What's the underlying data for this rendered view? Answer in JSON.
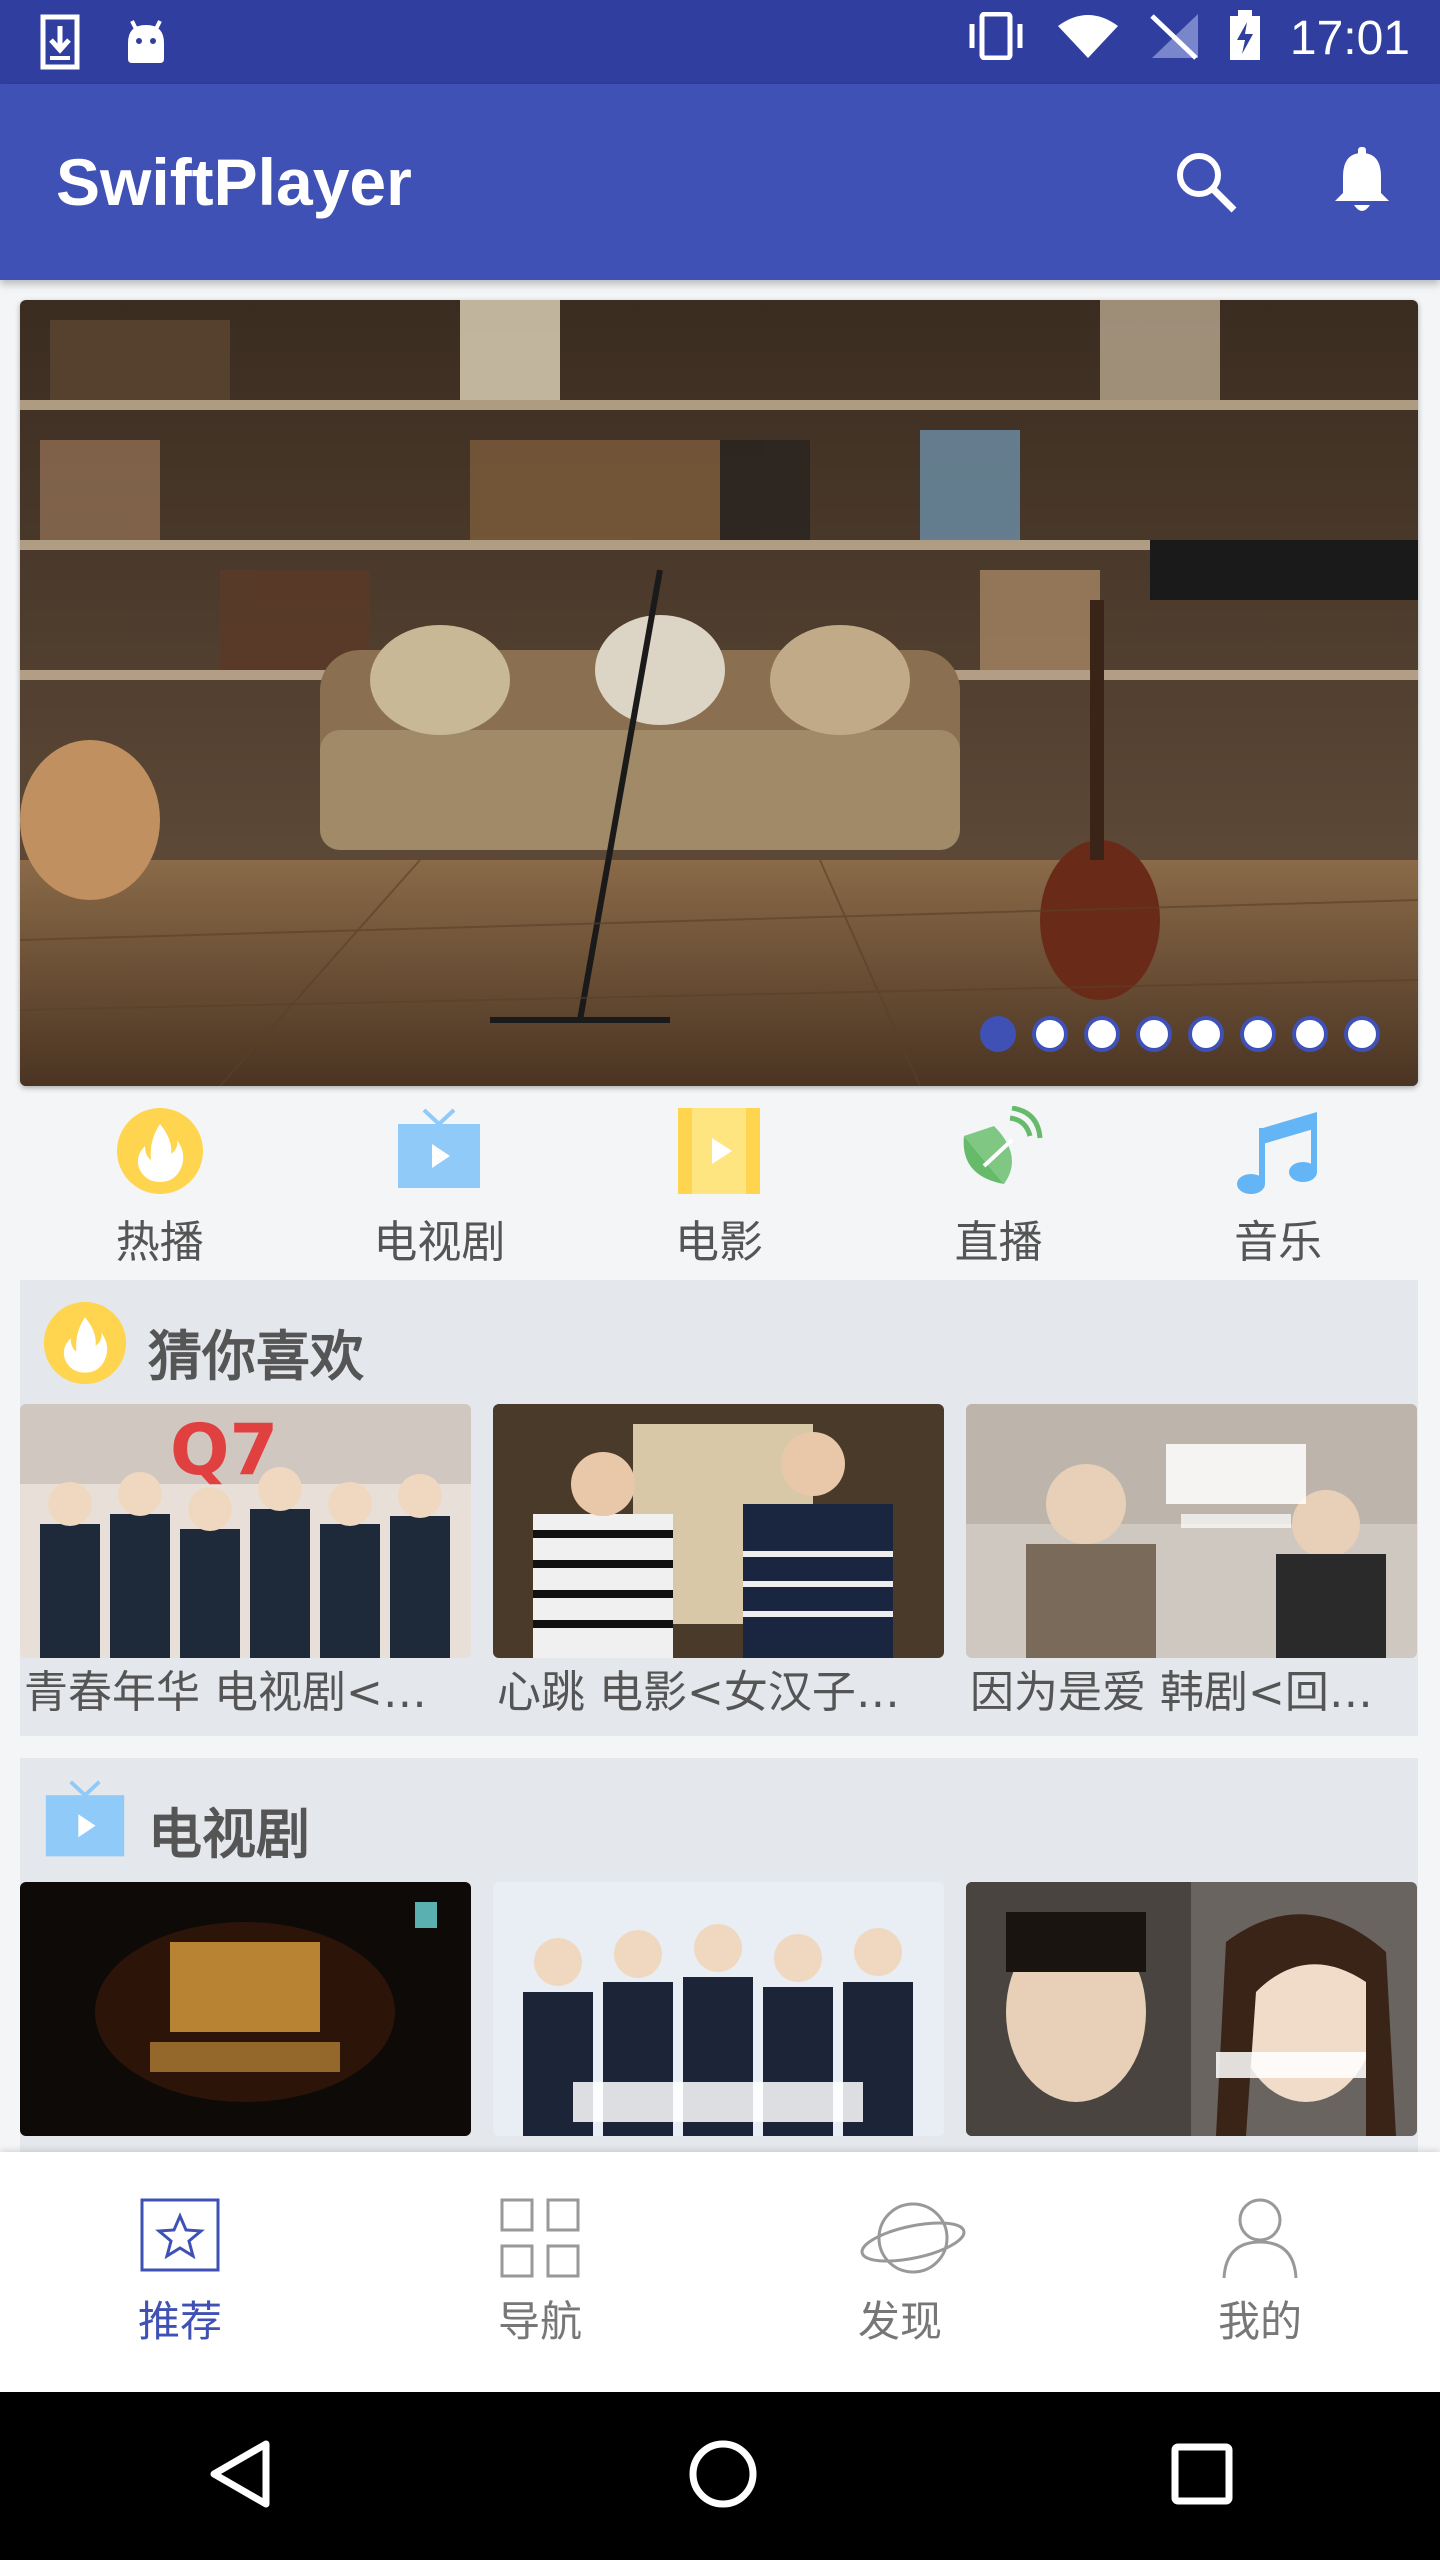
{
  "status_bar": {
    "time": "17:01"
  },
  "app_bar": {
    "title": "SwiftPlayer"
  },
  "banner": {
    "page_count": 8,
    "active_index": 0
  },
  "categories": [
    {
      "label": "热播",
      "icon": "fire-icon"
    },
    {
      "label": "电视剧",
      "icon": "tv-icon"
    },
    {
      "label": "电影",
      "icon": "film-icon"
    },
    {
      "label": "直播",
      "icon": "satellite-dish-icon"
    },
    {
      "label": "音乐",
      "icon": "music-note-icon"
    }
  ],
  "sections": [
    {
      "title": "猜你喜欢",
      "icon": "fire-icon",
      "items": [
        {
          "title": "青春年华 电视剧<…"
        },
        {
          "title": "心跳 电影<女汉子…"
        },
        {
          "title": "因为是爱 韩剧<回…"
        }
      ]
    },
    {
      "title": "电视剧",
      "icon": "tv-icon",
      "items": [
        {
          "title": ""
        },
        {
          "title": ""
        },
        {
          "title": ""
        }
      ]
    }
  ],
  "bottom_nav": [
    {
      "label": "推荐",
      "icon": "star-icon",
      "active": true
    },
    {
      "label": "导航",
      "icon": "grid-icon",
      "active": false
    },
    {
      "label": "发现",
      "icon": "planet-icon",
      "active": false
    },
    {
      "label": "我的",
      "icon": "person-icon",
      "active": false
    }
  ],
  "colors": {
    "primary": "#3f51b5",
    "primary_dark": "#303f9f",
    "fire": "#ffd54f",
    "tv": "#90caf9"
  }
}
